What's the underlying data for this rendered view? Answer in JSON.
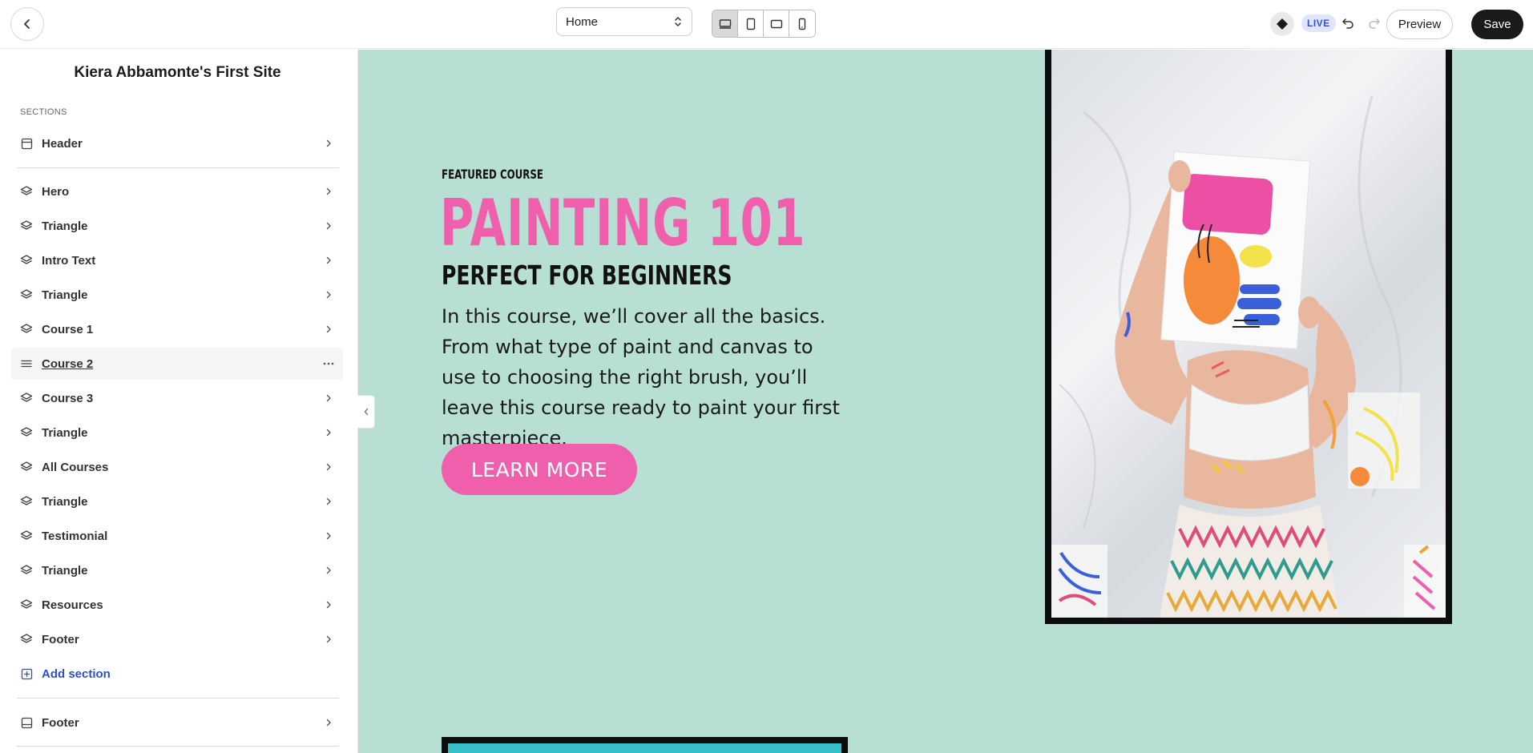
{
  "topbar": {
    "page_select_value": "Home",
    "live_badge": "LIVE",
    "preview_label": "Preview",
    "save_label": "Save"
  },
  "sidebar": {
    "site_title": "Kiera Abbamonte's First Site",
    "sections_label": "SECTIONS",
    "items": [
      {
        "label": "Header",
        "icon": "header-block-icon"
      },
      {
        "label": "Hero",
        "icon": "layers-icon"
      },
      {
        "label": "Triangle",
        "icon": "layers-icon"
      },
      {
        "label": "Intro Text",
        "icon": "layers-icon"
      },
      {
        "label": "Triangle",
        "icon": "layers-icon"
      },
      {
        "label": "Course 1",
        "icon": "layers-icon"
      },
      {
        "label": "Course 2",
        "icon": "drag-handle-icon"
      },
      {
        "label": "Course 3",
        "icon": "layers-icon"
      },
      {
        "label": "Triangle",
        "icon": "layers-icon"
      },
      {
        "label": "All Courses",
        "icon": "layers-icon"
      },
      {
        "label": "Triangle",
        "icon": "layers-icon"
      },
      {
        "label": "Testimonial",
        "icon": "layers-icon"
      },
      {
        "label": "Triangle",
        "icon": "layers-icon"
      },
      {
        "label": "Resources",
        "icon": "layers-icon"
      },
      {
        "label": "Footer",
        "icon": "layers-icon"
      }
    ],
    "add_section_label": "Add section",
    "footer_label": "Footer"
  },
  "canvas": {
    "eyebrow": "FEATURED COURSE",
    "title": "PAINTING 101",
    "subtitle": "PERFECT FOR BEGINNERS",
    "description": "In this course, we’ll cover all the basics. From what type of paint and canvas to use to choosing the right brush, you’ll leave this course ready to paint your first masterpiece.",
    "cta_label": "LEARN MORE"
  },
  "colors": {
    "canvas_bg": "#b8dfd4",
    "accent_pink": "#ef5fac",
    "live_badge_bg": "#dfe6fb",
    "live_badge_text": "#3552c9",
    "add_section_blue": "#2f4fc3",
    "save_bg": "#1a1a1a"
  }
}
